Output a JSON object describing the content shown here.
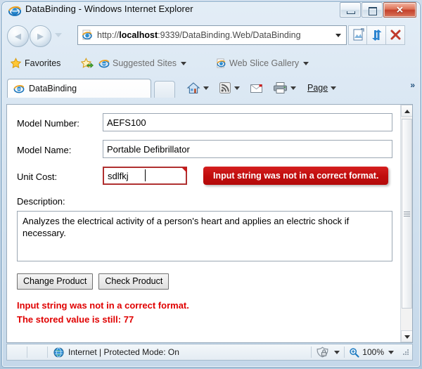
{
  "window": {
    "title": "DataBinding - Windows Internet Explorer",
    "minimize_label": "Minimize",
    "maximize_label": "Maximize",
    "close_label": "✕"
  },
  "navigation": {
    "back_label": "◄",
    "forward_label": "►",
    "recent_pages_label": "Recent Pages",
    "url_scheme": "http://",
    "url_host": "localhost",
    "url_path": ":9339/DataBinding.Web/DataBinding",
    "url_full": "http://localhost:9339/DataBinding.Web/DataBinding",
    "compatibility_label": "Compatibility View",
    "refresh_label": "Refresh",
    "stop_label": "Stop"
  },
  "favorites_bar": {
    "favorites_label": "Favorites",
    "add_favorites_label": "Add to Favorites Bar",
    "suggested_sites_label": "Suggested Sites",
    "web_slice_gallery_label": "Web Slice Gallery"
  },
  "tabs": {
    "active": {
      "label": "DataBinding"
    },
    "new_tab_label": "New Tab"
  },
  "command_bar": {
    "home_label": "Home",
    "feeds_label": "Feeds",
    "mail_label": "Read Mail",
    "print_label": "Print",
    "page_label": "Page",
    "more_label": "»"
  },
  "form": {
    "model_number": {
      "label": "Model Number:",
      "value": "AEFS100"
    },
    "model_name": {
      "label": "Model Name:",
      "value": "Portable Defibrillator"
    },
    "unit_cost": {
      "label": "Unit Cost:",
      "value": "sdlfkj",
      "error_tooltip": "Input string was not in a correct format."
    },
    "description": {
      "label": "Description:",
      "value": "Analyzes the electrical activity of a person's heart and applies an electric shock if necessary."
    },
    "buttons": {
      "change_product": "Change Product",
      "check_product": "Check Product"
    },
    "messages": {
      "line1": "Input string was not in a correct format.",
      "line2": "The stored value is still: 77",
      "color": "#e00000"
    }
  },
  "status_bar": {
    "zone_text": "Internet | Protected Mode: On",
    "security_label": "Security Zone",
    "zoom_value": "100%",
    "zoom_label": "Change Zoom Level"
  },
  "colors": {
    "error_red": "#c00d0d",
    "message_red": "#e00000",
    "frame_blue": "#aec7dc"
  }
}
